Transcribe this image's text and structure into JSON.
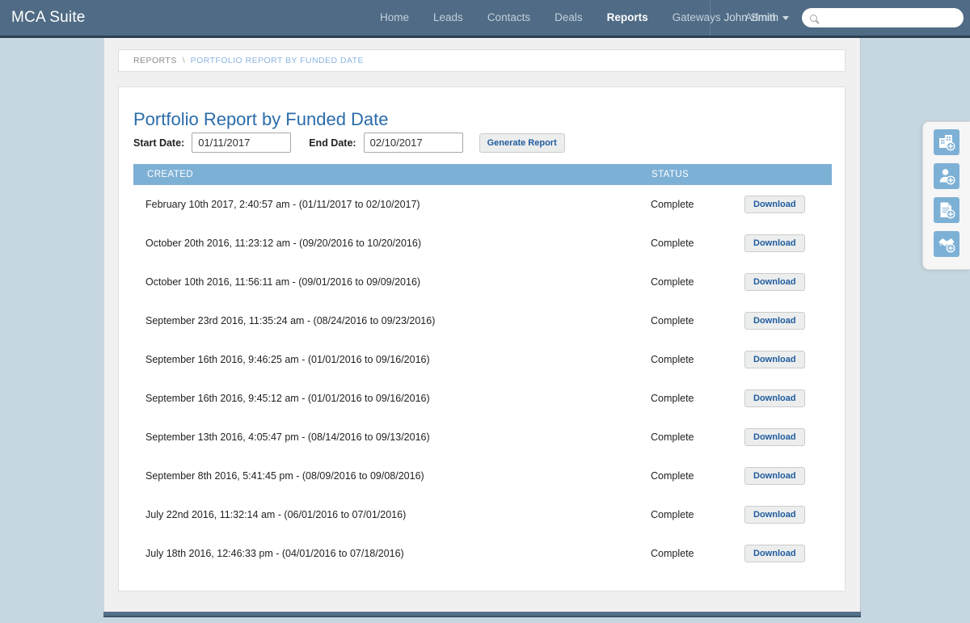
{
  "navbar": {
    "brand": "MCA Suite",
    "links": [
      {
        "label": "Home",
        "active": false
      },
      {
        "label": "Leads",
        "active": false
      },
      {
        "label": "Contacts",
        "active": false
      },
      {
        "label": "Deals",
        "active": false
      },
      {
        "label": "Reports",
        "active": true
      },
      {
        "label": "Gateways",
        "active": false
      },
      {
        "label": "Admin",
        "active": false
      }
    ],
    "user": "John Smith",
    "search_placeholder": "",
    "search_value": "",
    "search_icon": "search-icon",
    "caret_icon": "chevron-down-icon",
    "bg_color": "#4f6b85"
  },
  "breadcrumb": {
    "root": "REPORTS",
    "separator": "\\",
    "current": "PORTFOLIO REPORT BY FUNDED DATE"
  },
  "page": {
    "title": "Portfolio Report by Funded Date",
    "accent_color": "#2b6caa"
  },
  "filters": {
    "start_label": "Start Date:",
    "start_value": "01/11/2017",
    "end_label": "End Date:",
    "end_value": "02/10/2017",
    "generate_label": "Generate Report"
  },
  "table": {
    "header_color": "#7db0d5",
    "columns": [
      "CREATED",
      "STATUS"
    ],
    "action_label": "Download",
    "rows": [
      {
        "created": "February 10th 2017, 2:40:57 am - (01/11/2017 to 02/10/2017)",
        "status": "Complete"
      },
      {
        "created": "October 20th 2016, 11:23:12 am - (09/20/2016 to 10/20/2016)",
        "status": "Complete"
      },
      {
        "created": "October 10th 2016, 11:56:11 am - (09/01/2016 to 09/09/2016)",
        "status": "Complete"
      },
      {
        "created": "September 23rd 2016, 11:35:24 am - (08/24/2016 to 09/23/2016)",
        "status": "Complete"
      },
      {
        "created": "September 16th 2016, 9:46:25 am - (01/01/2016 to 09/16/2016)",
        "status": "Complete"
      },
      {
        "created": "September 16th 2016, 9:45:12 am - (01/01/2016 to 09/16/2016)",
        "status": "Complete"
      },
      {
        "created": "September 13th 2016, 4:05:47 pm - (08/14/2016 to 09/13/2016)",
        "status": "Complete"
      },
      {
        "created": "September 8th 2016, 5:41:45 pm - (08/09/2016 to 09/08/2016)",
        "status": "Complete"
      },
      {
        "created": "July 22nd 2016, 11:32:14 am - (06/01/2016 to 07/01/2016)",
        "status": "Complete"
      },
      {
        "created": "July 18th 2016, 12:46:33 pm - (04/01/2016 to 07/18/2016)",
        "status": "Complete"
      }
    ]
  },
  "quickbar": {
    "items": [
      {
        "icon": "add-company-icon"
      },
      {
        "icon": "add-contact-icon"
      },
      {
        "icon": "add-document-icon"
      },
      {
        "icon": "add-deal-icon"
      }
    ]
  }
}
